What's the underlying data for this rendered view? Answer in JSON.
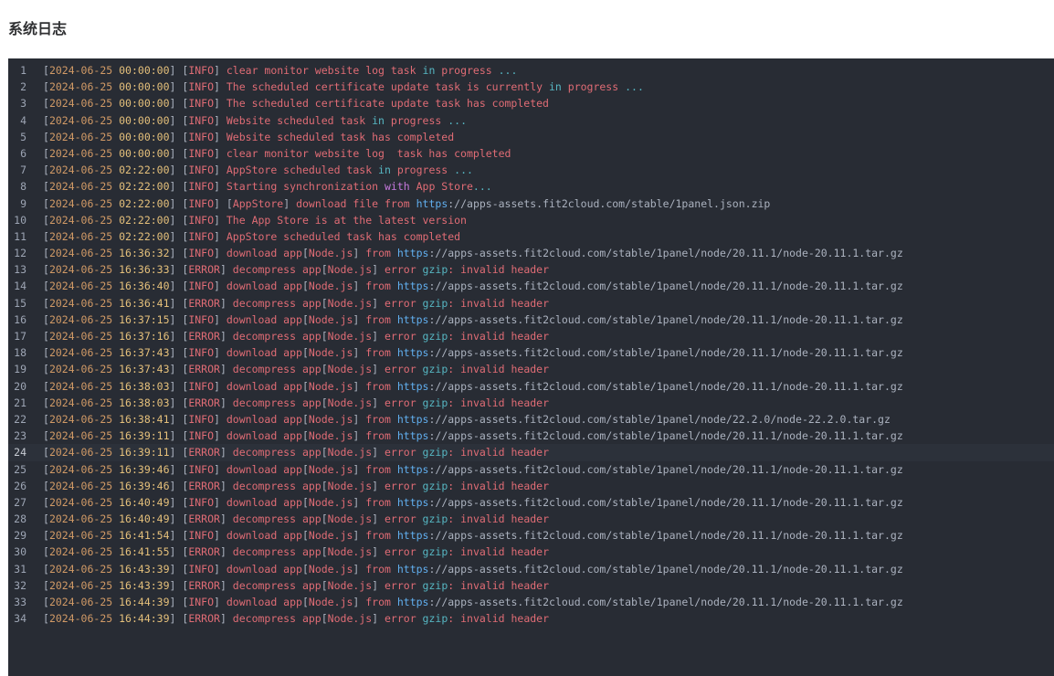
{
  "page": {
    "title": "系统日志"
  },
  "log": {
    "active_line": 24,
    "lines": [
      {
        "n": "1",
        "date": "2024-06-25",
        "time": "00:00:00",
        "level": "INFO",
        "msg": "clear monitor website log task in progress ..."
      },
      {
        "n": "2",
        "date": "2024-06-25",
        "time": "00:00:00",
        "level": "INFO",
        "msg": "The scheduled certificate update task is currently in progress ..."
      },
      {
        "n": "3",
        "date": "2024-06-25",
        "time": "00:00:00",
        "level": "INFO",
        "msg": "The scheduled certificate update task has completed"
      },
      {
        "n": "4",
        "date": "2024-06-25",
        "time": "00:00:00",
        "level": "INFO",
        "msg": "Website scheduled task in progress ..."
      },
      {
        "n": "5",
        "date": "2024-06-25",
        "time": "00:00:00",
        "level": "INFO",
        "msg": "Website scheduled task has completed"
      },
      {
        "n": "6",
        "date": "2024-06-25",
        "time": "00:00:00",
        "level": "INFO",
        "msg": "clear monitor website log  task has completed"
      },
      {
        "n": "7",
        "date": "2024-06-25",
        "time": "02:22:00",
        "level": "INFO",
        "msg": "AppStore scheduled task in progress ..."
      },
      {
        "n": "8",
        "date": "2024-06-25",
        "time": "02:22:00",
        "level": "INFO",
        "msg": "Starting synchronization with App Store..."
      },
      {
        "n": "9",
        "date": "2024-06-25",
        "time": "02:22:00",
        "level": "INFO",
        "msg": "[AppStore] download file from https://apps-assets.fit2cloud.com/stable/1panel.json.zip"
      },
      {
        "n": "10",
        "date": "2024-06-25",
        "time": "02:22:00",
        "level": "INFO",
        "msg": "The App Store is at the latest version"
      },
      {
        "n": "11",
        "date": "2024-06-25",
        "time": "02:22:00",
        "level": "INFO",
        "msg": "AppStore scheduled task has completed"
      },
      {
        "n": "12",
        "date": "2024-06-25",
        "time": "16:36:32",
        "level": "INFO",
        "msg": "download app[Node.js] from https://apps-assets.fit2cloud.com/stable/1panel/node/20.11.1/node-20.11.1.tar.gz"
      },
      {
        "n": "13",
        "date": "2024-06-25",
        "time": "16:36:33",
        "level": "ERROR",
        "msg": "decompress app[Node.js] error gzip: invalid header"
      },
      {
        "n": "14",
        "date": "2024-06-25",
        "time": "16:36:40",
        "level": "INFO",
        "msg": "download app[Node.js] from https://apps-assets.fit2cloud.com/stable/1panel/node/20.11.1/node-20.11.1.tar.gz"
      },
      {
        "n": "15",
        "date": "2024-06-25",
        "time": "16:36:41",
        "level": "ERROR",
        "msg": "decompress app[Node.js] error gzip: invalid header"
      },
      {
        "n": "16",
        "date": "2024-06-25",
        "time": "16:37:15",
        "level": "INFO",
        "msg": "download app[Node.js] from https://apps-assets.fit2cloud.com/stable/1panel/node/20.11.1/node-20.11.1.tar.gz"
      },
      {
        "n": "17",
        "date": "2024-06-25",
        "time": "16:37:16",
        "level": "ERROR",
        "msg": "decompress app[Node.js] error gzip: invalid header"
      },
      {
        "n": "18",
        "date": "2024-06-25",
        "time": "16:37:43",
        "level": "INFO",
        "msg": "download app[Node.js] from https://apps-assets.fit2cloud.com/stable/1panel/node/20.11.1/node-20.11.1.tar.gz"
      },
      {
        "n": "19",
        "date": "2024-06-25",
        "time": "16:37:43",
        "level": "ERROR",
        "msg": "decompress app[Node.js] error gzip: invalid header"
      },
      {
        "n": "20",
        "date": "2024-06-25",
        "time": "16:38:03",
        "level": "INFO",
        "msg": "download app[Node.js] from https://apps-assets.fit2cloud.com/stable/1panel/node/20.11.1/node-20.11.1.tar.gz"
      },
      {
        "n": "21",
        "date": "2024-06-25",
        "time": "16:38:03",
        "level": "ERROR",
        "msg": "decompress app[Node.js] error gzip: invalid header"
      },
      {
        "n": "22",
        "date": "2024-06-25",
        "time": "16:38:41",
        "level": "INFO",
        "msg": "download app[Node.js] from https://apps-assets.fit2cloud.com/stable/1panel/node/22.2.0/node-22.2.0.tar.gz"
      },
      {
        "n": "23",
        "date": "2024-06-25",
        "time": "16:39:11",
        "level": "INFO",
        "msg": "download app[Node.js] from https://apps-assets.fit2cloud.com/stable/1panel/node/20.11.1/node-20.11.1.tar.gz"
      },
      {
        "n": "24",
        "date": "2024-06-25",
        "time": "16:39:11",
        "level": "ERROR",
        "msg": "decompress app[Node.js] error gzip: invalid header"
      },
      {
        "n": "25",
        "date": "2024-06-25",
        "time": "16:39:46",
        "level": "INFO",
        "msg": "download app[Node.js] from https://apps-assets.fit2cloud.com/stable/1panel/node/20.11.1/node-20.11.1.tar.gz"
      },
      {
        "n": "26",
        "date": "2024-06-25",
        "time": "16:39:46",
        "level": "ERROR",
        "msg": "decompress app[Node.js] error gzip: invalid header"
      },
      {
        "n": "27",
        "date": "2024-06-25",
        "time": "16:40:49",
        "level": "INFO",
        "msg": "download app[Node.js] from https://apps-assets.fit2cloud.com/stable/1panel/node/20.11.1/node-20.11.1.tar.gz"
      },
      {
        "n": "28",
        "date": "2024-06-25",
        "time": "16:40:49",
        "level": "ERROR",
        "msg": "decompress app[Node.js] error gzip: invalid header"
      },
      {
        "n": "29",
        "date": "2024-06-25",
        "time": "16:41:54",
        "level": "INFO",
        "msg": "download app[Node.js] from https://apps-assets.fit2cloud.com/stable/1panel/node/20.11.1/node-20.11.1.tar.gz"
      },
      {
        "n": "30",
        "date": "2024-06-25",
        "time": "16:41:55",
        "level": "ERROR",
        "msg": "decompress app[Node.js] error gzip: invalid header"
      },
      {
        "n": "31",
        "date": "2024-06-25",
        "time": "16:43:39",
        "level": "INFO",
        "msg": "download app[Node.js] from https://apps-assets.fit2cloud.com/stable/1panel/node/20.11.1/node-20.11.1.tar.gz"
      },
      {
        "n": "32",
        "date": "2024-06-25",
        "time": "16:43:39",
        "level": "ERROR",
        "msg": "decompress app[Node.js] error gzip: invalid header"
      },
      {
        "n": "33",
        "date": "2024-06-25",
        "time": "16:44:39",
        "level": "INFO",
        "msg": "download app[Node.js] from https://apps-assets.fit2cloud.com/stable/1panel/node/20.11.1/node-20.11.1.tar.gz"
      },
      {
        "n": "34",
        "date": "2024-06-25",
        "time": "16:44:39",
        "level": "ERROR",
        "msg": "decompress app[Node.js] error gzip: invalid header"
      }
    ]
  }
}
